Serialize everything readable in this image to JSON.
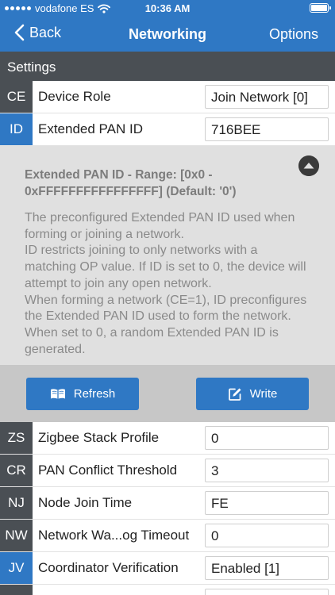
{
  "status_bar": {
    "carrier": "vodafone ES",
    "time": "10:36 AM"
  },
  "nav": {
    "back_label": "Back",
    "title": "Networking",
    "options_label": "Options"
  },
  "section": {
    "title": "Settings"
  },
  "top_rows": [
    {
      "code": "CE",
      "name": "Device Role",
      "value": "Join Network [0]"
    },
    {
      "code": "ID",
      "name": "Extended PAN ID",
      "value": "716BEE"
    }
  ],
  "help": {
    "title": "Extended PAN ID - Range: [0x0 - 0xFFFFFFFFFFFFFFFF] (Default: '0')",
    "lines": [
      "The preconfigured Extended PAN ID used when forming or joining a network.",
      "ID restricts joining to only networks with a matching OP value. If ID is set to 0, the device will attempt to join any open network.",
      "When forming a network (CE=1), ID preconfigures the Extended PAN ID used to form the network. When set to 0, a random Extended PAN ID is generated."
    ]
  },
  "buttons": {
    "refresh_label": "Refresh",
    "write_label": "Write"
  },
  "rows": [
    {
      "code": "ZS",
      "name": "Zigbee Stack Profile",
      "value": "0"
    },
    {
      "code": "CR",
      "name": "PAN Conflict Threshold",
      "value": "3"
    },
    {
      "code": "NJ",
      "name": "Node Join Time",
      "value": "FE"
    },
    {
      "code": "NW",
      "name": "Network Wa...og Timeout",
      "value": "0"
    },
    {
      "code": "JV",
      "name": "Coordinator Verification",
      "value": "Enabled [1]"
    }
  ],
  "colors": {
    "accent": "#2f78c4",
    "dark_code": "#4a4f54",
    "panel": "#e0e0e0",
    "button_bar": "#c7c7c7"
  },
  "icons": {
    "back": "chevron-left-icon",
    "collapse": "chevron-up-circle-icon",
    "refresh": "book-open-icon",
    "write": "edit-icon",
    "wifi": "wifi-icon",
    "battery": "battery-icon"
  }
}
